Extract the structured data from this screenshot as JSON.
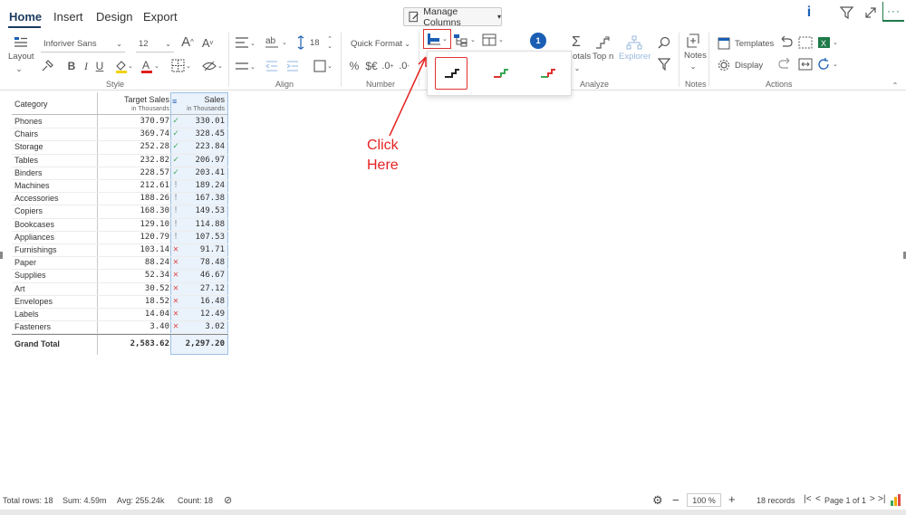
{
  "tabs": [
    "Home",
    "Insert",
    "Design",
    "Export"
  ],
  "manage_columns": "Manage Columns",
  "style": {
    "layout_label": "Layout",
    "font_name": "Inforiver Sans",
    "font_size": "12",
    "group_label": "Style"
  },
  "align": {
    "spacing_value": "18",
    "group_label": "Align"
  },
  "number": {
    "quick_format": "Quick Format",
    "group_label": "Number"
  },
  "analyze": {
    "totals_label": "otals",
    "topn_label": "Top n",
    "explorer_label": "Explorer",
    "group_label": "Analyze",
    "badge": "1"
  },
  "notes": {
    "label": "Notes",
    "group_label": "Notes"
  },
  "actions": {
    "templates": "Templates",
    "display": "Display",
    "group_label": "Actions"
  },
  "annotation": {
    "line1": "Click",
    "line2": "Here"
  },
  "table": {
    "col_category": "Category",
    "col_target": "Target Sales",
    "col_target_sub": "in Thousands",
    "col_sales": "Sales",
    "col_sales_sub": "in Thousands",
    "rows": [
      {
        "category": "Phones",
        "target": "370.97",
        "sales": "330.01",
        "status": "check"
      },
      {
        "category": "Chairs",
        "target": "369.74",
        "sales": "328.45",
        "status": "check"
      },
      {
        "category": "Storage",
        "target": "252.28",
        "sales": "223.84",
        "status": "check"
      },
      {
        "category": "Tables",
        "target": "232.82",
        "sales": "206.97",
        "status": "check"
      },
      {
        "category": "Binders",
        "target": "228.57",
        "sales": "203.41",
        "status": "check"
      },
      {
        "category": "Machines",
        "target": "212.61",
        "sales": "189.24",
        "status": "warn"
      },
      {
        "category": "Accessories",
        "target": "188.26",
        "sales": "167.38",
        "status": "warn"
      },
      {
        "category": "Copiers",
        "target": "168.30",
        "sales": "149.53",
        "status": "warn"
      },
      {
        "category": "Bookcases",
        "target": "129.10",
        "sales": "114.88",
        "status": "warn"
      },
      {
        "category": "Appliances",
        "target": "120.79",
        "sales": "107.53",
        "status": "warn"
      },
      {
        "category": "Furnishings",
        "target": "103.14",
        "sales": "91.71",
        "status": "cross"
      },
      {
        "category": "Paper",
        "target": "88.24",
        "sales": "78.48",
        "status": "cross"
      },
      {
        "category": "Supplies",
        "target": "52.34",
        "sales": "46.67",
        "status": "cross"
      },
      {
        "category": "Art",
        "target": "30.52",
        "sales": "27.12",
        "status": "cross"
      },
      {
        "category": "Envelopes",
        "target": "18.52",
        "sales": "16.48",
        "status": "cross"
      },
      {
        "category": "Labels",
        "target": "14.04",
        "sales": "12.49",
        "status": "cross"
      },
      {
        "category": "Fasteners",
        "target": "3.40",
        "sales": "3.02",
        "status": "cross"
      }
    ],
    "total_label": "Grand Total",
    "total_target": "2,583.62",
    "total_sales": "2,297.20"
  },
  "status_bar": {
    "total_rows": "Total rows: 18",
    "sum": "Sum: 4.59m",
    "avg": "Avg: 255.24k",
    "count": "Count: 18",
    "zoom": "100 %",
    "records": "18 records",
    "page": "Page 1 of 1"
  },
  "colors": {
    "check": "#3aa655",
    "warn": "#999999",
    "cross": "#e04848",
    "accent": "#1c3a5e",
    "annotation": "#e52222"
  }
}
